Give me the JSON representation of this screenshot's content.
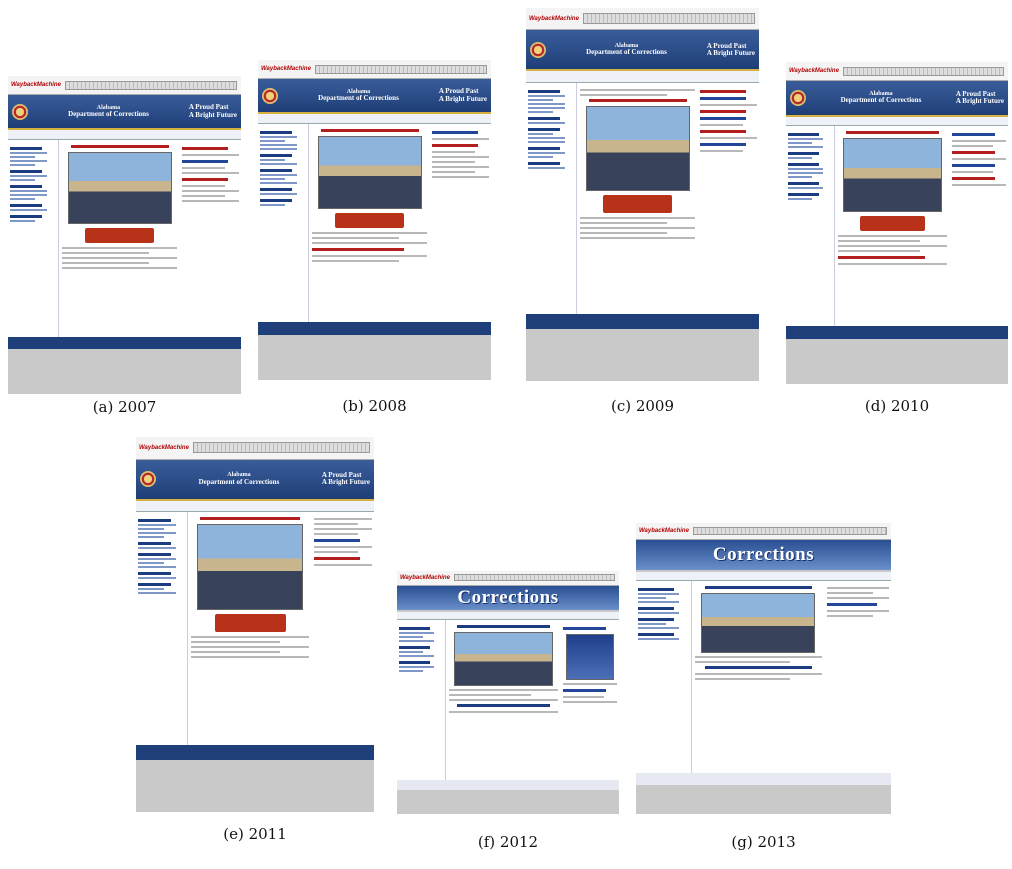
{
  "panels": [
    {
      "caption": "(a) 2007",
      "style": "old",
      "wb_logo": "WaybackMachine",
      "title_line1": "Alabama",
      "title_line2": "Department of Corrections",
      "tagline1": "A Proud Past",
      "tagline2": "A Bright Future"
    },
    {
      "caption": "(b) 2008",
      "style": "old",
      "wb_logo": "WaybackMachine",
      "title_line1": "Alabama",
      "title_line2": "Department of Corrections",
      "tagline1": "A Proud Past",
      "tagline2": "A Bright Future"
    },
    {
      "caption": "(c) 2009",
      "style": "old",
      "wb_logo": "WaybackMachine",
      "title_line1": "Alabama",
      "title_line2": "Department of Corrections",
      "tagline1": "A Proud Past",
      "tagline2": "A Bright Future"
    },
    {
      "caption": "(d) 2010",
      "style": "old",
      "wb_logo": "WaybackMachine",
      "title_line1": "Alabama",
      "title_line2": "Department of Corrections",
      "tagline1": "A Proud Past",
      "tagline2": "A Bright Future"
    },
    {
      "caption": "(e) 2011",
      "style": "old",
      "wb_logo": "WaybackMachine",
      "title_line1": "Alabama",
      "title_line2": "Department of Corrections",
      "tagline1": "A Proud Past",
      "tagline2": "A Bright Future"
    },
    {
      "caption": "(f) 2012",
      "style": "new",
      "wb_logo": "WaybackMachine",
      "brand": "Corrections"
    },
    {
      "caption": "(g) 2013",
      "style": "new",
      "wb_logo": "WaybackMachine",
      "brand": "Corrections"
    }
  ]
}
